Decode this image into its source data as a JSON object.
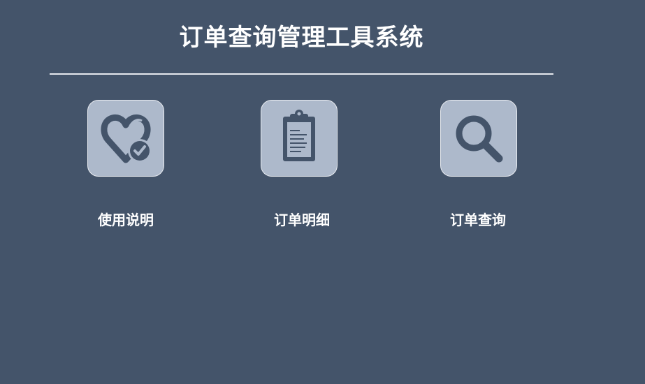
{
  "page": {
    "title": "订单查询管理工具系统"
  },
  "theme": {
    "background": "#44546a",
    "tile_background": "#adb9cb",
    "tile_border": "#e8ebf0",
    "icon_color": "#44546a",
    "text_color": "#ffffff"
  },
  "menu": {
    "items": [
      {
        "label": "使用说明",
        "icon": "heart-check-icon"
      },
      {
        "label": "订单明细",
        "icon": "clipboard-icon"
      },
      {
        "label": "订单查询",
        "icon": "magnifier-icon"
      }
    ]
  }
}
